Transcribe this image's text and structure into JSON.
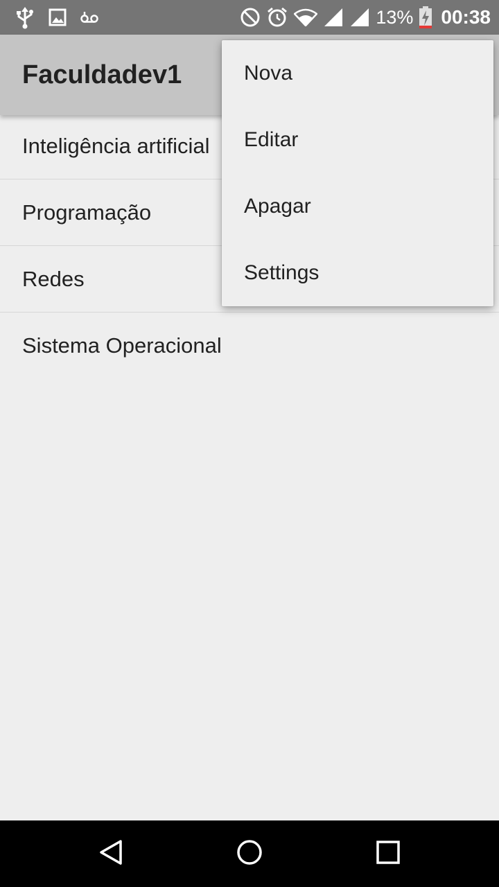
{
  "status_bar": {
    "icons_left": [
      "usb-icon",
      "image-icon",
      "voicemail-icon"
    ],
    "icons_right": [
      "do-not-disturb-icon",
      "alarm-icon",
      "wifi-icon",
      "signal-icon",
      "signal-icon",
      "battery-charging-icon"
    ],
    "battery_percent": "13%",
    "time": "00:38"
  },
  "app_bar": {
    "title": "Faculdadev1"
  },
  "list": {
    "items": [
      {
        "label": "Inteligência artificial"
      },
      {
        "label": "Programação"
      },
      {
        "label": "Redes"
      },
      {
        "label": "Sistema Operacional"
      }
    ]
  },
  "overflow_menu": {
    "items": [
      {
        "label": "Nova"
      },
      {
        "label": "Editar"
      },
      {
        "label": "Apagar"
      },
      {
        "label": "Settings"
      }
    ]
  },
  "nav_bar": {
    "icons": [
      "back-icon",
      "home-icon",
      "recents-icon"
    ]
  },
  "colors": {
    "status_bar": "#757575",
    "app_bar": "#c4c4c4",
    "background": "#eeeeee",
    "nav_bar": "#000000"
  }
}
